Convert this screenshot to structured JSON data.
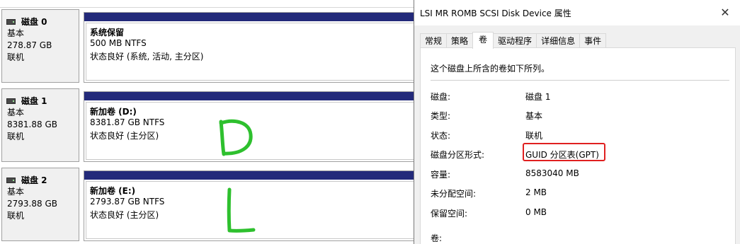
{
  "disks": [
    {
      "name": "磁盘 0",
      "type": "基本",
      "size": "278.87 GB",
      "status": "联机",
      "volume": {
        "title": "系统保留",
        "fs": "500 MB NTFS",
        "state": "状态良好 (系统, 活动, 主分区)"
      }
    },
    {
      "name": "磁盘 1",
      "type": "基本",
      "size": "8381.88 GB",
      "status": "联机",
      "volume": {
        "title": "新加卷  (D:)",
        "fs": "8381.87 GB NTFS",
        "state": "状态良好 (主分区)"
      }
    },
    {
      "name": "磁盘 2",
      "type": "基本",
      "size": "2793.88 GB",
      "status": "联机",
      "volume": {
        "title": "新加卷  (E:)",
        "fs": "2793.87 GB NTFS",
        "state": "状态良好 (主分区)"
      }
    }
  ],
  "colors": {
    "volume_bar": "#232a7a",
    "annotation_green": "#2ec02e",
    "highlight_red": "#e02020"
  },
  "dialog": {
    "title": "LSI MR ROMB SCSI Disk Device 属性",
    "close_icon": "close-icon",
    "tabs": [
      "常规",
      "策略",
      "卷",
      "驱动程序",
      "详细信息",
      "事件"
    ],
    "active_tab": "卷",
    "intro": "这个磁盘上所含的卷如下所列。",
    "props": [
      {
        "label": "磁盘:",
        "value": "磁盘 1"
      },
      {
        "label": "类型:",
        "value": "基本"
      },
      {
        "label": "状态:",
        "value": "联机"
      },
      {
        "label": "磁盘分区形式:",
        "value": "GUID 分区表(GPT)"
      },
      {
        "label": "容量:",
        "value": "8583040 MB"
      },
      {
        "label": "未分配空间:",
        "value": "2 MB"
      },
      {
        "label": "保留空间:",
        "value": "0 MB"
      }
    ],
    "volumes_label": "卷:"
  }
}
